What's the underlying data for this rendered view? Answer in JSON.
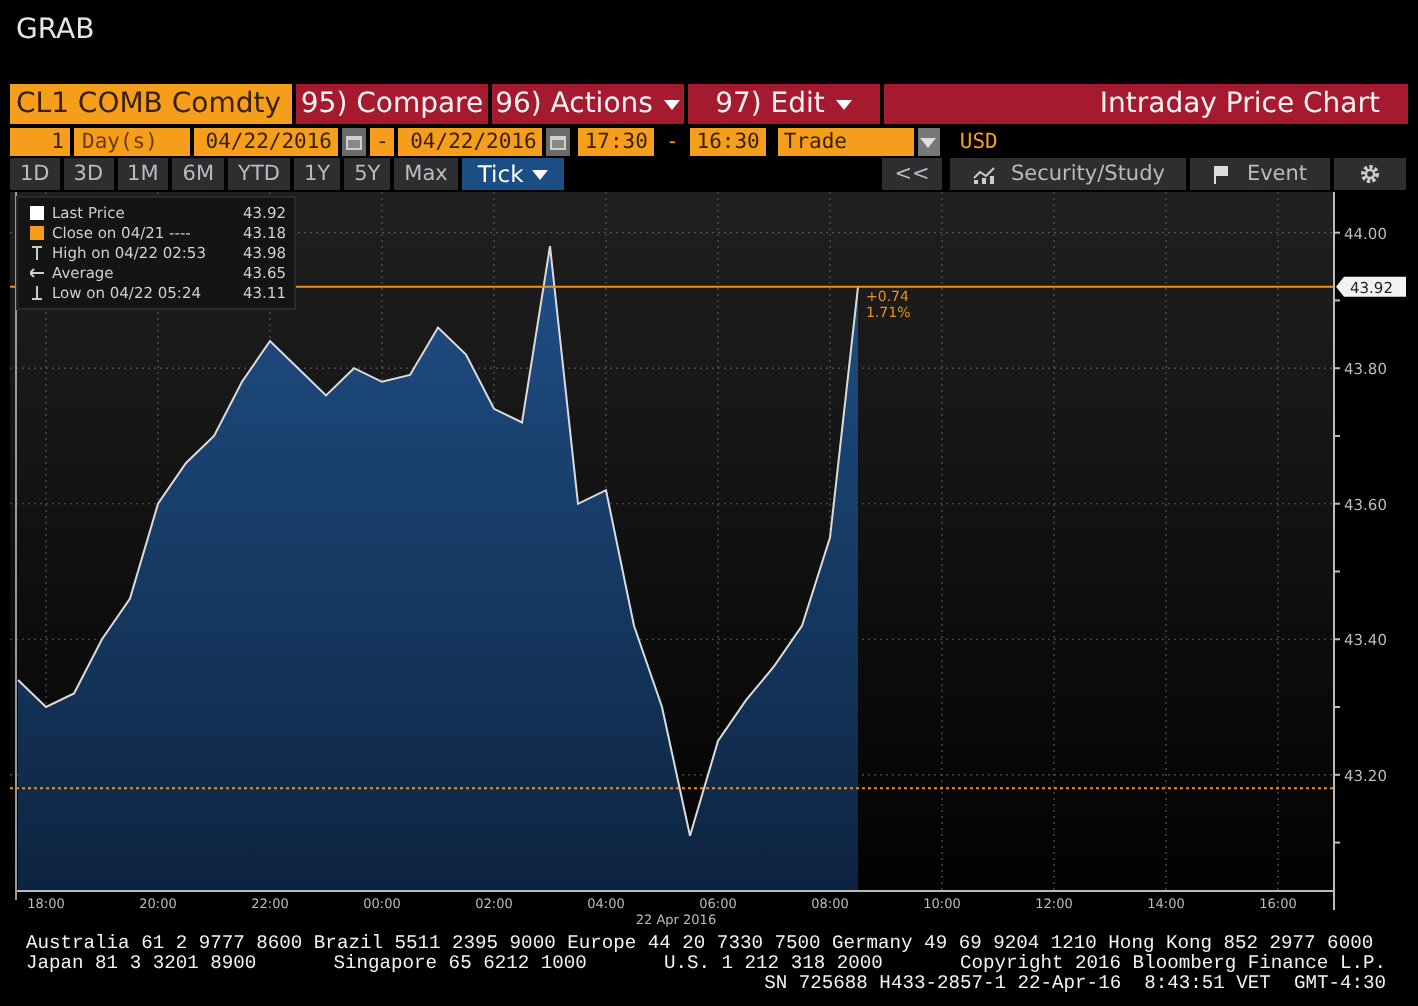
{
  "title": "GRAB",
  "toolbar": {
    "security": "CL1 COMB Comdty",
    "buttons": [
      {
        "label": "95) Compare",
        "menu": false
      },
      {
        "label": "96) Actions",
        "menu": true
      },
      {
        "label": "97) Edit",
        "menu": true
      }
    ],
    "panel_title": "Intraday Price Chart"
  },
  "range": {
    "count": "1",
    "unit": "Day(s)",
    "start_date": "04/22/2016",
    "end_date": "04/22/2016",
    "separator_1": "-",
    "start_time": "17:30",
    "separator_2": "-",
    "end_time": "16:30",
    "event": "Trade",
    "currency": "USD"
  },
  "periods": [
    {
      "label": "1D",
      "selected": false,
      "menu": false
    },
    {
      "label": "3D",
      "selected": false,
      "menu": false
    },
    {
      "label": "1M",
      "selected": false,
      "menu": false
    },
    {
      "label": "6M",
      "selected": false,
      "menu": false
    },
    {
      "label": "YTD",
      "selected": false,
      "menu": false
    },
    {
      "label": "1Y",
      "selected": false,
      "menu": false
    },
    {
      "label": "5Y",
      "selected": false,
      "menu": false
    },
    {
      "label": "Max",
      "selected": false,
      "menu": false
    },
    {
      "label": "Tick",
      "selected": true,
      "menu": true
    }
  ],
  "actions": [
    {
      "kind": "collapse",
      "label": "<<"
    },
    {
      "kind": "study",
      "label": "Security/Study"
    },
    {
      "kind": "event",
      "label": "Event"
    },
    {
      "kind": "settings"
    }
  ],
  "chart": {
    "legend": [
      {
        "kind": "last",
        "label": "Last Price",
        "value": "43.92"
      },
      {
        "kind": "close",
        "label": "Close on 04/21 ----",
        "value": "43.18"
      },
      {
        "kind": "high",
        "label": "High on 04/22 02:53",
        "value": "43.98"
      },
      {
        "kind": "average",
        "label": "Average",
        "value": "43.65"
      },
      {
        "kind": "low",
        "label": "Low on 04/22 05:24",
        "value": "43.11"
      }
    ],
    "change": "+0.74",
    "change_percent": "1.71%",
    "date_label": "22 Apr 2016",
    "chart_data": {
      "type": "area",
      "categories": [
        null,
        "18:00",
        null,
        null,
        null,
        "20:00",
        null,
        null,
        null,
        "22:00",
        null,
        null,
        null,
        "00:00",
        null,
        null,
        null,
        "02:00",
        null,
        null,
        null,
        "04:00",
        null,
        null,
        null,
        "06:00",
        null,
        null,
        null,
        "08:00",
        null,
        null,
        null,
        "10:00",
        null,
        null,
        null,
        "12:00",
        null,
        null,
        null,
        "14:00",
        null,
        null,
        null,
        "16:00",
        null
      ],
      "series": [
        {
          "color": "#dcdcdc",
          "values": [
            43.34,
            43.3,
            43.32,
            43.4,
            43.46,
            43.6,
            43.66,
            43.7,
            43.78,
            43.84,
            43.8,
            43.76,
            43.8,
            43.78,
            43.79,
            43.86,
            43.82,
            43.74,
            43.72,
            43.98,
            43.6,
            43.62,
            43.42,
            43.3,
            43.11,
            43.25,
            43.31,
            43.36,
            43.42,
            43.55,
            43.92,
            null,
            null,
            null,
            null,
            null,
            null,
            null,
            null,
            null,
            null,
            null,
            null,
            null,
            null,
            null,
            null
          ]
        }
      ],
      "ylim": [
        43.03,
        44.06
      ],
      "yticks": [
        {
          "value": 43.2,
          "label": "43.20"
        },
        {
          "value": 43.4,
          "label": "43.40"
        },
        {
          "value": 43.6,
          "label": "43.60"
        },
        {
          "value": 43.8,
          "label": "43.80"
        },
        {
          "value": 44.0,
          "label": "44.00"
        }
      ],
      "grid": true,
      "ref_lines": [
        {
          "axis": "y",
          "value": 43.92,
          "label": "43.92"
        },
        {
          "axis": "y",
          "value": 43.18
        }
      ]
    }
  },
  "footer": {
    "line_1": "Australia 61 2 9777 8600 Brazil 5511 2395 9000 Europe 44 20 7330 7500 Germany 49 69 9204 1210 Hong Kong 852 2977 6000",
    "line_2": [
      "Japan 81 3 3201 8900",
      "Singapore 65 6212 1000",
      "U.S. 1 212 318 2000",
      "Copyright 2016 Bloomberg Finance L.P."
    ],
    "line_3": "SN 725688 H433-2857-1 22-Apr-16  8:43:51 VET  GMT-4:30"
  }
}
